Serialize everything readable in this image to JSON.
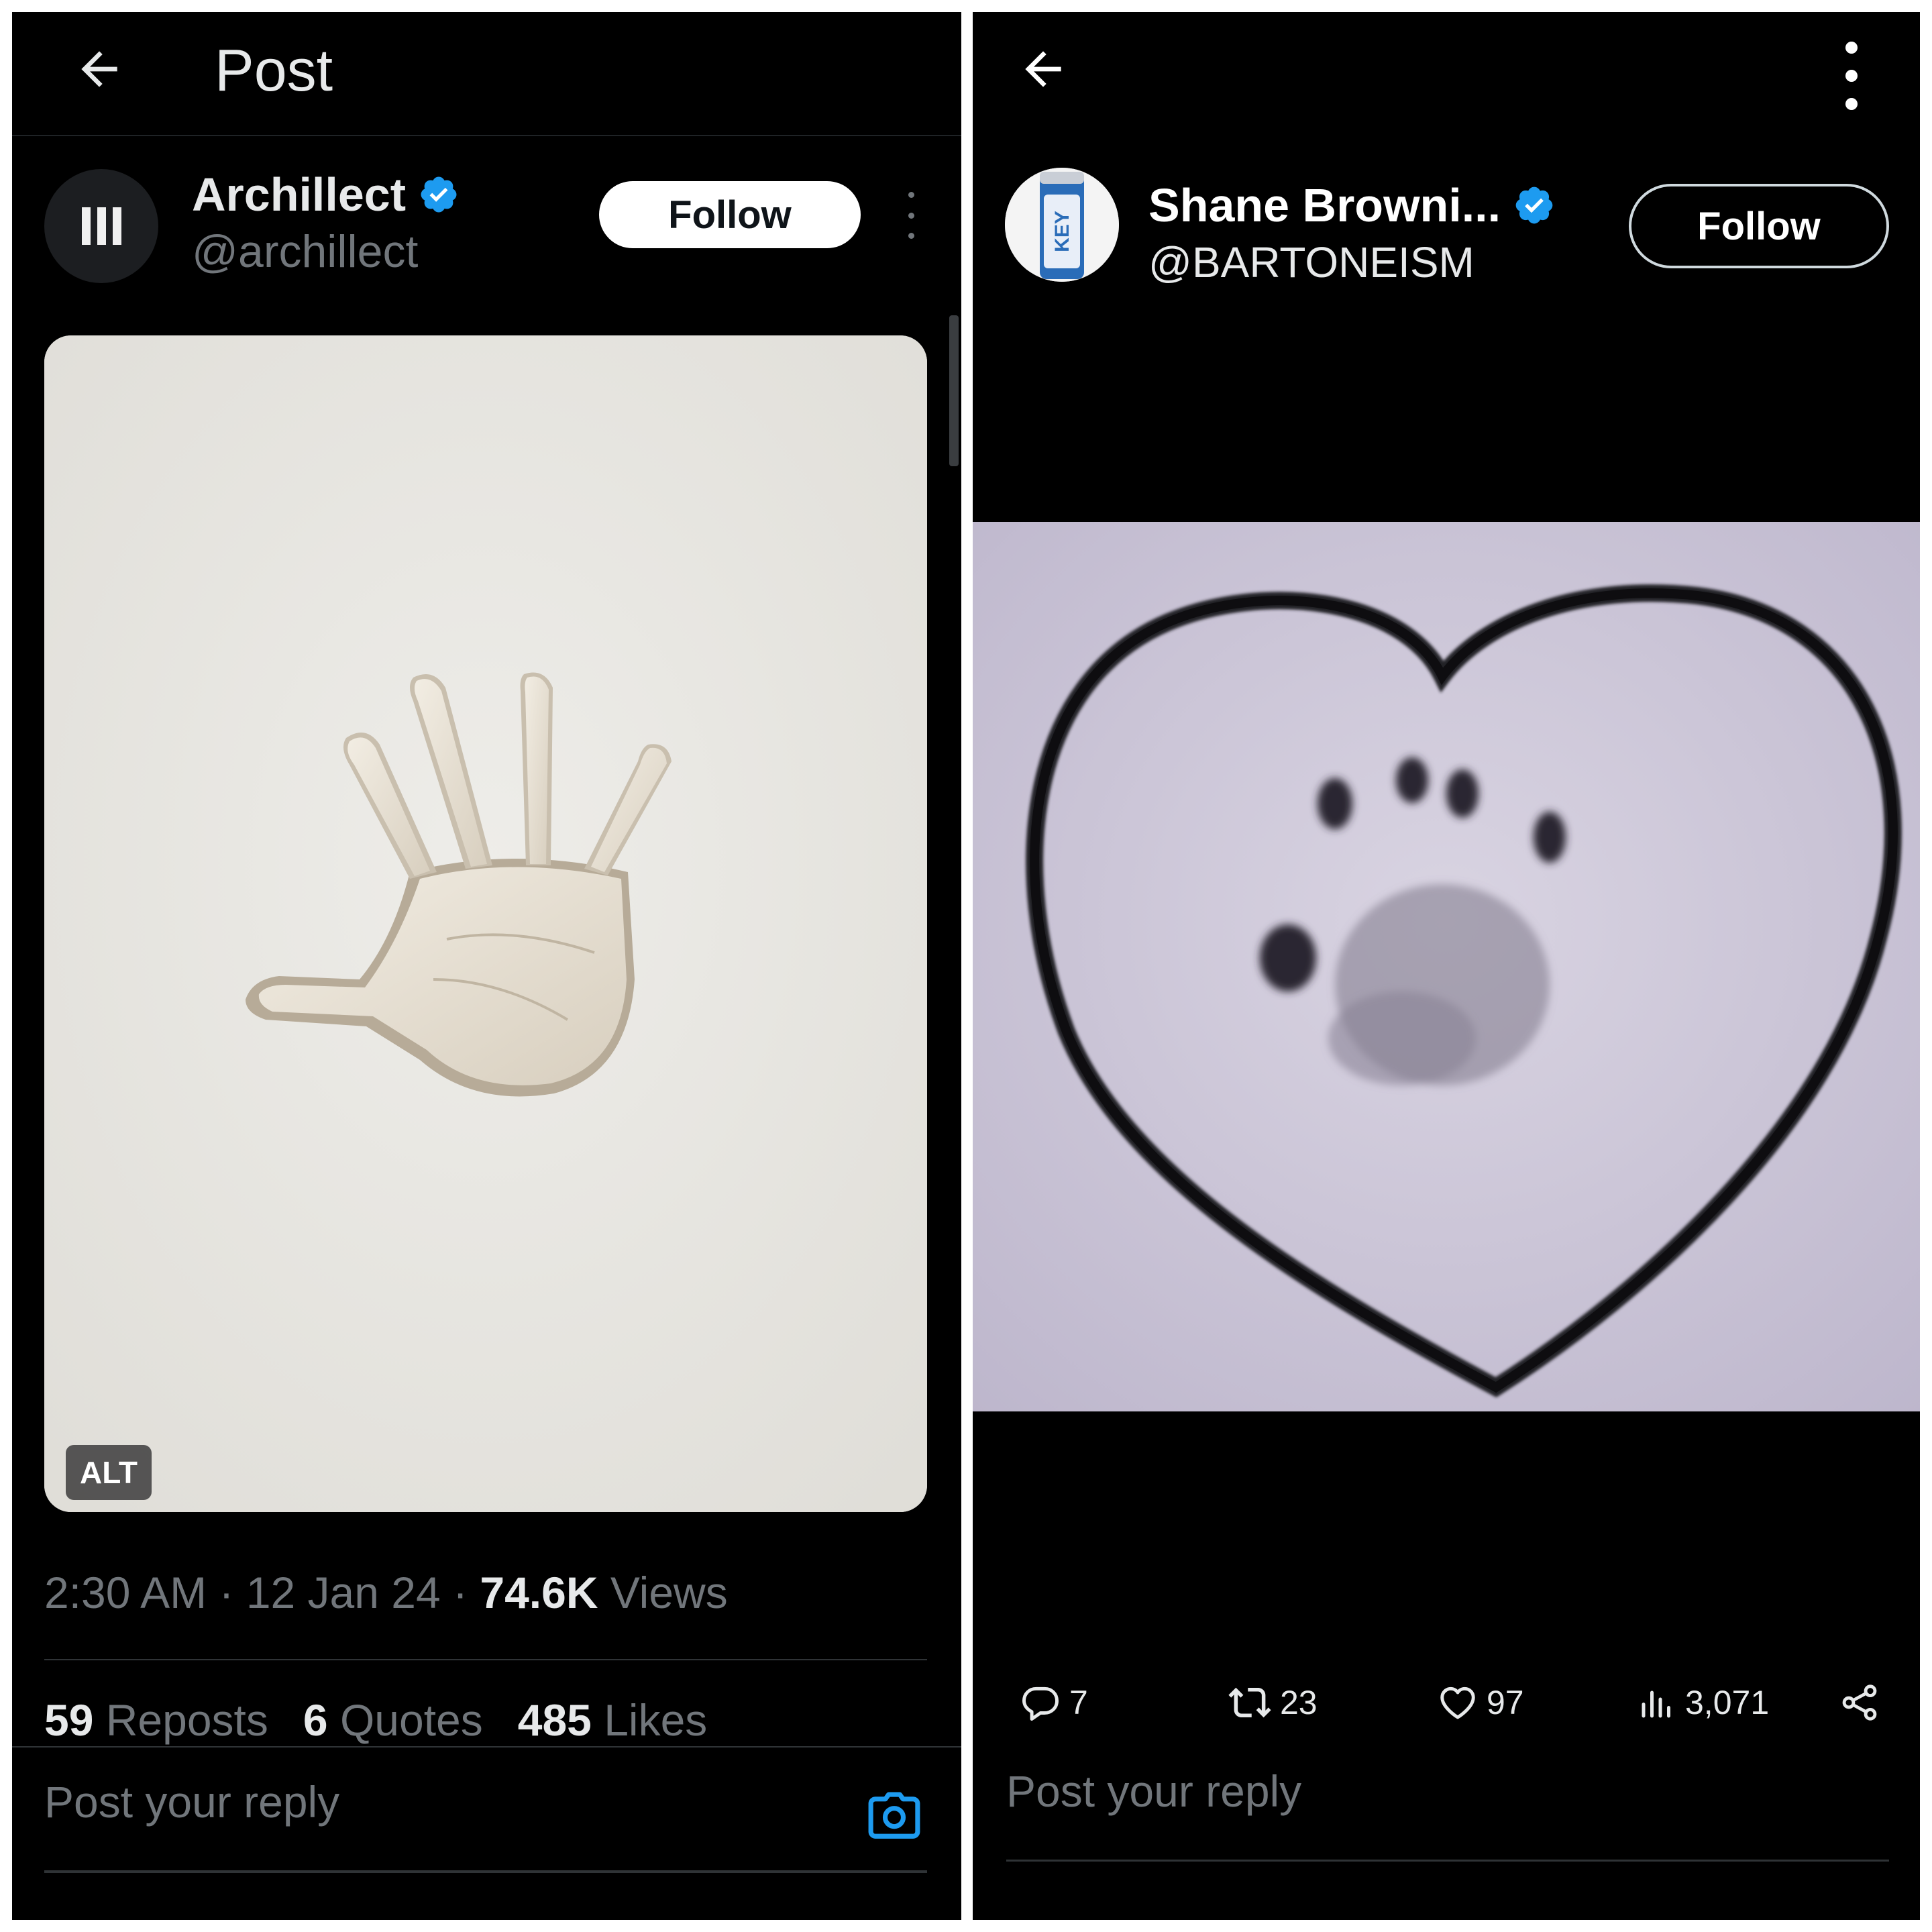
{
  "left": {
    "header": {
      "title": "Post",
      "back_icon": "arrow-left-icon"
    },
    "author": {
      "name": "Archillect",
      "handle": "@archillect",
      "verified_icon": "verified-badge-icon",
      "avatar_icon": "archillect-logo-icon",
      "follow_label": "Follow",
      "more_icon": "more-vertical-icon"
    },
    "media": {
      "alt_label": "ALT"
    },
    "meta": {
      "time": "2:30 AM",
      "sep": " · ",
      "date": "12 Jan 24",
      "views_count": "74.6K",
      "views_label": " Views"
    },
    "stats": {
      "reposts_count": "59",
      "reposts_label": " Reposts",
      "quotes_count": "6",
      "quotes_label": " Quotes",
      "likes_count": "485",
      "likes_label": " Likes"
    },
    "reply": {
      "placeholder": "Post your reply",
      "camera_icon": "camera-icon"
    }
  },
  "right": {
    "header": {
      "back_icon": "arrow-left-icon",
      "more_icon": "more-vertical-icon"
    },
    "author": {
      "name": "Shane Browni...",
      "handle": "@BARTONEISM",
      "verified_icon": "verified-badge-icon",
      "follow_label": "Follow"
    },
    "actions": {
      "replies": "7",
      "reposts": "23",
      "likes": "97",
      "views": "3,071"
    },
    "reply": {
      "placeholder": "Post your reply"
    }
  },
  "colors": {
    "background": "#000000",
    "accent": "#1d9bf0",
    "muted_text": "#71767b",
    "primary_text": "#e7e9ea"
  }
}
